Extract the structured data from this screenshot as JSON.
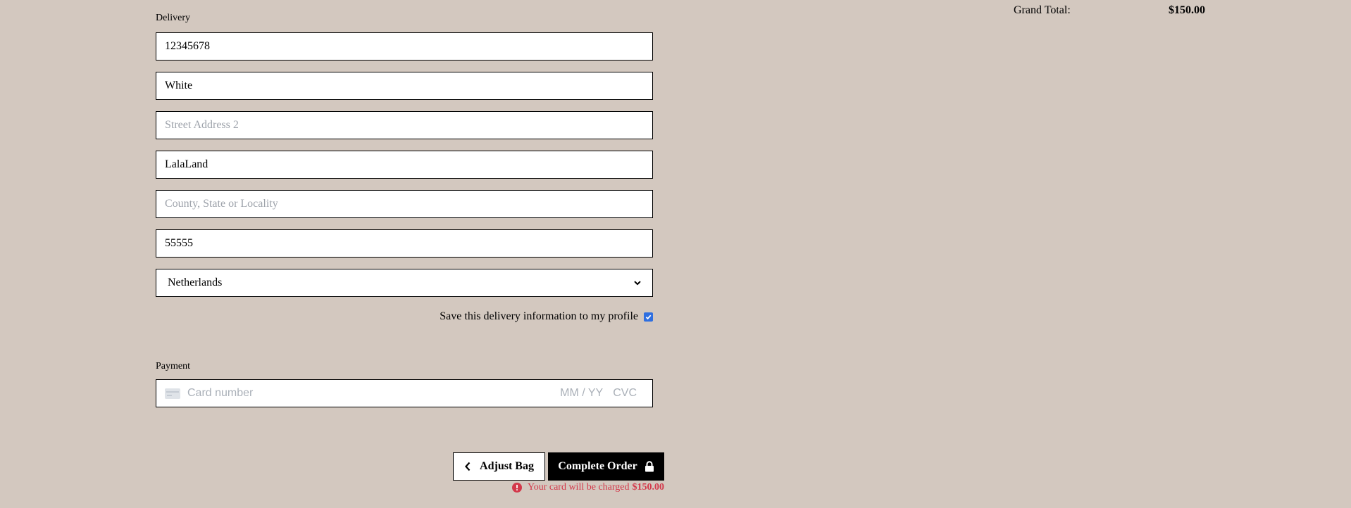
{
  "delivery": {
    "section_label": "Delivery",
    "fields": [
      {
        "value": "12345678",
        "placeholder": ""
      },
      {
        "value": "White",
        "placeholder": ""
      },
      {
        "value": "",
        "placeholder": "Street Address 2"
      },
      {
        "value": "LalaLand",
        "placeholder": ""
      },
      {
        "value": "",
        "placeholder": "County, State or Locality"
      },
      {
        "value": "55555",
        "placeholder": ""
      }
    ],
    "country": "Netherlands",
    "save_label": "Save this delivery information to my profile",
    "save_checked": true
  },
  "payment": {
    "section_label": "Payment",
    "card_number_placeholder": "Card number",
    "expiry_placeholder": "MM / YY",
    "cvc_placeholder": "CVC"
  },
  "actions": {
    "adjust_label": "Adjust Bag",
    "complete_label": "Complete Order",
    "charge_prefix": "Your card will be charged",
    "charge_amount": "$150.00"
  },
  "summary": {
    "grand_total_label": "Grand Total:",
    "grand_total_value": "$150.00"
  },
  "colors": {
    "background": "#d3c8bf",
    "error": "#d3384a",
    "checkbox": "#2f6fe0"
  }
}
